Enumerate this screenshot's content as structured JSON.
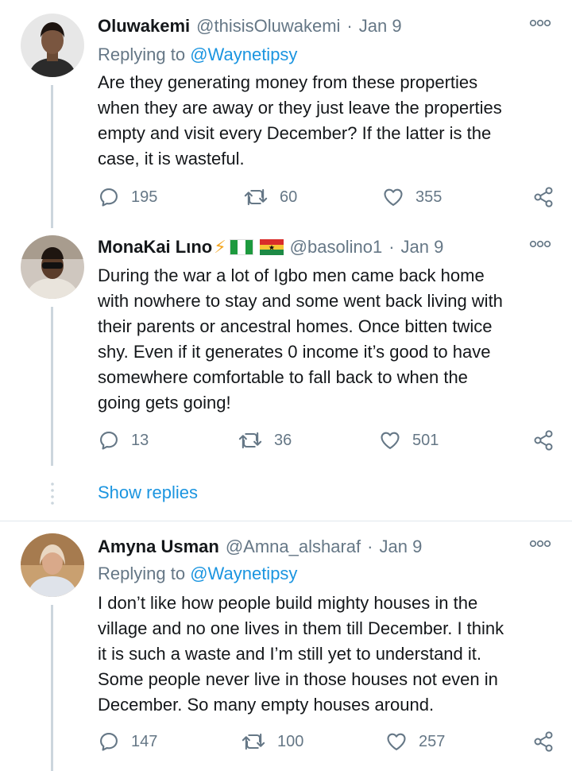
{
  "tweets": [
    {
      "name": "Oluwakemi",
      "handle": "@thisisOluwakemi",
      "separator": "·",
      "date": "Jan 9",
      "replying_prefix": "Replying to",
      "replying_to": "@Waynetipsy",
      "lines": [
        "Are they generating money from these properties",
        "when they are away or they just leave the properties",
        "empty and visit every December? If the latter is the",
        "case, it is wasteful."
      ],
      "replies": "195",
      "retweets": "60",
      "likes": "355"
    },
    {
      "name": "MonaKai Lιno",
      "name_emoji": "⚡",
      "handle": "@basolino1",
      "separator": "·",
      "date": "Jan 9",
      "lines": [
        "During the war a lot of Igbo men came back home",
        "with nowhere to stay and some went back living with",
        "their parents or ancestral homes. Once bitten twice",
        "shy. Even if it generates 0 income it’s good to have",
        "somewhere comfortable to fall back to when the",
        "going gets going!"
      ],
      "replies": "13",
      "retweets": "36",
      "likes": "501"
    },
    {
      "name": "Amyna Usman",
      "handle": "@Amna_alsharaf",
      "separator": "·",
      "date": "Jan 9",
      "replying_prefix": "Replying to",
      "replying_to": "@Waynetipsy",
      "lines": [
        "I don’t like how people build mighty houses in the",
        "village and no one lives in them till December. I think",
        "it is such a waste and I’m still yet to understand it.",
        "Some people never live in those houses not even in",
        "December.  So many empty houses around."
      ],
      "replies": "147",
      "retweets": "100",
      "likes": "257"
    }
  ],
  "show_replies": "Show replies",
  "icons": {
    "reply": "reply-icon",
    "retweet": "retweet-icon",
    "like": "heart-icon",
    "share": "share-icon",
    "more": "more-icon"
  },
  "colors": {
    "link": "#1b95e0",
    "muted": "#657786",
    "text": "#14171a",
    "thread_line": "#ccd6dd"
  }
}
